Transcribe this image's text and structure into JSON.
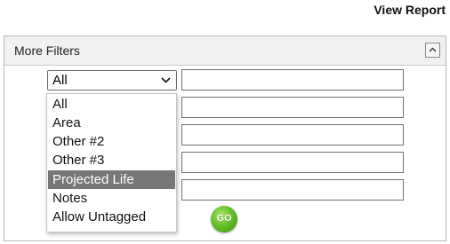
{
  "header": {
    "view_report_label": "View Report"
  },
  "panel": {
    "title": "More Filters",
    "collapse_icon": "chevron-up-icon"
  },
  "filter": {
    "selected": "All",
    "options": [
      "All",
      "Area",
      "Other #2",
      "Other #3",
      "Projected Life",
      "Notes",
      "Allow Untagged"
    ],
    "highlighted_option": "Projected Life"
  },
  "inputs": [
    {
      "value": ""
    },
    {
      "value": ""
    },
    {
      "value": ""
    },
    {
      "value": ""
    },
    {
      "value": ""
    }
  ],
  "go_button": {
    "label": "GO",
    "color": "#64c02b"
  }
}
